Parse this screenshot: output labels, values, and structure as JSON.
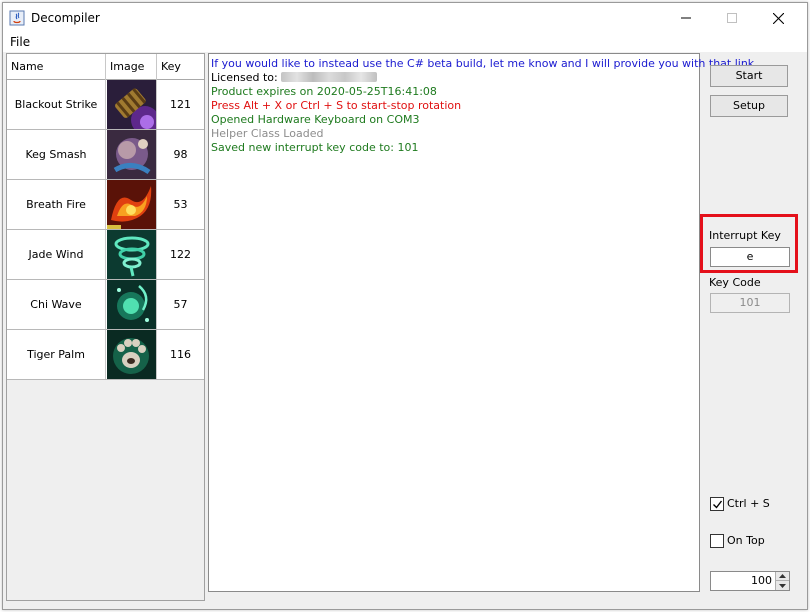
{
  "window": {
    "title": "Decompiler",
    "menu": [
      "File"
    ]
  },
  "table": {
    "headers": [
      "Name",
      "Image",
      "Key"
    ],
    "rows": [
      {
        "name": "Blackout Strike",
        "key": "121",
        "icon": "blackout-strike-icon"
      },
      {
        "name": "Keg Smash",
        "key": "98",
        "icon": "keg-smash-icon"
      },
      {
        "name": "Breath Fire",
        "key": "53",
        "icon": "breath-fire-icon"
      },
      {
        "name": "Jade Wind",
        "key": "122",
        "icon": "jade-wind-icon"
      },
      {
        "name": "Chi Wave",
        "key": "57",
        "icon": "chi-wave-icon"
      },
      {
        "name": "Tiger Palm",
        "key": "116",
        "icon": "tiger-palm-icon"
      }
    ]
  },
  "log": {
    "lines": [
      {
        "text": "If you would like to instead use the C# beta build, let me know and I will provide you with that link.",
        "color": "#1a1ad0"
      },
      {
        "text": "Licensed to: ",
        "color": "#000000"
      },
      {
        "text": "Product expires on 2020-05-25T16:41:08",
        "color": "#1e7a1e"
      },
      {
        "text": "Press Alt + X or Ctrl + S to start-stop rotation",
        "color": "#e01010"
      },
      {
        "text": "Opened Hardware Keyboard on COM3",
        "color": "#1e7a1e"
      },
      {
        "text": "Helper Class Loaded",
        "color": "#8c8c8c"
      },
      {
        "text": "Saved new interrupt key code to: 101",
        "color": "#1e7a1e"
      }
    ]
  },
  "controls": {
    "start_label": "Start",
    "setup_label": "Setup",
    "interrupt_key_label": "Interrupt Key",
    "interrupt_key_value": "e",
    "key_code_label": "Key Code",
    "key_code_value": "101",
    "ctrl_s_label": "Ctrl + S",
    "ctrl_s_checked": true,
    "on_top_label": "On Top",
    "on_top_checked": false,
    "spinner_value": "100"
  },
  "colors": {
    "highlight": "#e4101a"
  }
}
